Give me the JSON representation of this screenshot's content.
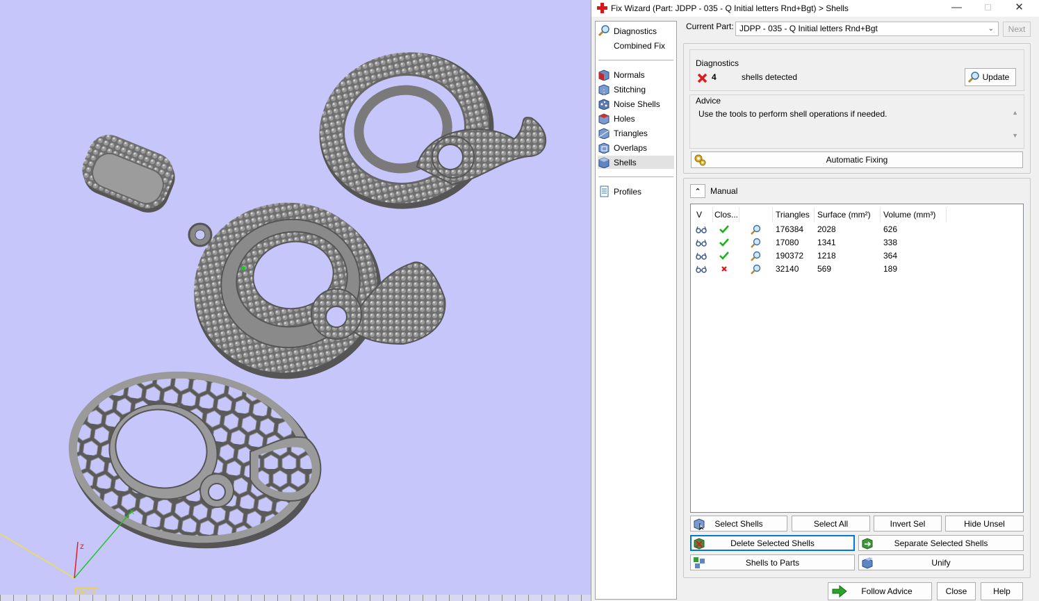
{
  "viewport": {
    "axis_z_label": "z",
    "axis_x_label": "x",
    "wcs_label": "WCS"
  },
  "window": {
    "title": "Fix Wizard (Part: JDPP - 035 - Q Initial letters Rnd+Bgt) > Shells",
    "minimize": "—",
    "maximize": "☐",
    "close": "✕"
  },
  "nav": {
    "items": [
      {
        "label": "Diagnostics",
        "icon": "magnifier-icon"
      },
      {
        "label": "Combined Fix",
        "icon": "combined-fix-icon"
      },
      {
        "label": "Normals",
        "icon": "normals-cube-icon"
      },
      {
        "label": "Stitching",
        "icon": "stitching-cube-icon"
      },
      {
        "label": "Noise Shells",
        "icon": "noise-shells-icon"
      },
      {
        "label": "Holes",
        "icon": "holes-cube-icon"
      },
      {
        "label": "Triangles",
        "icon": "triangles-cube-icon"
      },
      {
        "label": "Overlaps",
        "icon": "overlaps-cube-icon"
      },
      {
        "label": "Shells",
        "icon": "shells-cube-icon"
      },
      {
        "label": "Profiles",
        "icon": "profiles-doc-icon"
      }
    ],
    "selected": "Shells"
  },
  "current_part": {
    "label": "Current Part:",
    "value": "JDPP - 035 - Q Initial letters Rnd+Bgt",
    "next_label": "Next"
  },
  "diagnostics": {
    "group_label": "Diagnostics",
    "count": "4",
    "message": "shells detected",
    "update_label": "Update",
    "advice_label": "Advice",
    "advice_text": "Use the tools to perform shell operations if needed.",
    "auto_fix_label": "Automatic Fixing"
  },
  "manual": {
    "label": "Manual",
    "columns": [
      "V",
      "Clos...",
      "",
      "Triangles",
      "Surface (mm²)",
      "Volume (mm³)"
    ],
    "rows": [
      {
        "closed": true,
        "triangles": "176384",
        "surface": "2028",
        "volume": "626"
      },
      {
        "closed": true,
        "triangles": "17080",
        "surface": "1341",
        "volume": "338"
      },
      {
        "closed": true,
        "triangles": "190372",
        "surface": "1218",
        "volume": "364"
      },
      {
        "closed": false,
        "triangles": "32140",
        "surface": "569",
        "volume": "189"
      }
    ],
    "select_shells": "Select Shells",
    "select_all": "Select All",
    "invert_sel": "Invert Sel",
    "hide_unsel": "Hide Unsel",
    "delete_selected": "Delete Selected Shells",
    "separate_selected": "Separate Selected Shells",
    "shells_to_parts": "Shells to Parts",
    "unify": "Unify"
  },
  "footer": {
    "follow_advice": "Follow Advice",
    "close": "Close",
    "help": "Help"
  },
  "colors": {
    "viewport_bg": "#c6c6fa",
    "check_green": "#17b317",
    "cross_red": "#e01010",
    "selection_border": "#0078d7"
  }
}
